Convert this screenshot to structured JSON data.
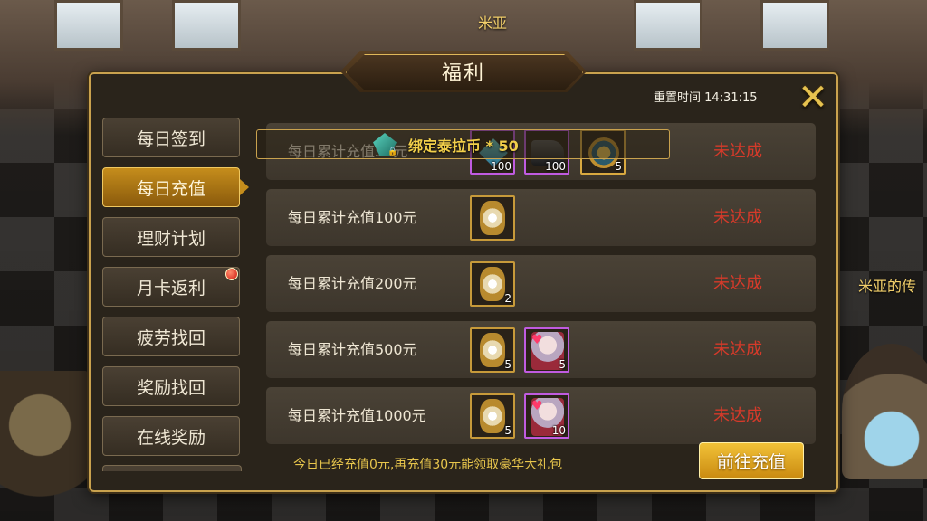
{
  "scene": {
    "npc_name": "米亚",
    "side_text": "米亚的传"
  },
  "panel": {
    "title": "福利",
    "reset_time": "重置时间 14:31:15"
  },
  "sidebar": {
    "items": [
      {
        "label": "每日签到"
      },
      {
        "label": "每日充值"
      },
      {
        "label": "理财计划"
      },
      {
        "label": "月卡返利"
      },
      {
        "label": "疲劳找回"
      },
      {
        "label": "奖励找回"
      },
      {
        "label": "在线奖励"
      }
    ],
    "active_index": 1
  },
  "rows": [
    {
      "label": "每日累计充值50元",
      "status": "未达成",
      "items": [
        {
          "icon": "gem-item",
          "count": "100"
        },
        {
          "icon": "boot-item",
          "count": "100"
        },
        {
          "icon": "coin-item",
          "count": "5"
        }
      ]
    },
    {
      "label": "每日累计充值100元",
      "status": "未达成",
      "items": [
        {
          "icon": "jar-item",
          "count": ""
        }
      ]
    },
    {
      "label": "每日累计充值200元",
      "status": "未达成",
      "items": [
        {
          "icon": "jar-item",
          "count": "2"
        }
      ]
    },
    {
      "label": "每日累计充值500元",
      "status": "未达成",
      "items": [
        {
          "icon": "jar-item",
          "count": "5"
        },
        {
          "icon": "portrait-card-item",
          "count": "5"
        }
      ]
    },
    {
      "label": "每日累计充值1000元",
      "status": "未达成",
      "items": [
        {
          "icon": "jar-item",
          "count": "5"
        },
        {
          "icon": "portrait-card-item",
          "count": "10"
        }
      ]
    }
  ],
  "tooltip": {
    "text": "绑定泰拉币 * 50"
  },
  "footer": {
    "note": "今日已经充值0元,再充值30元能领取豪华大礼包",
    "goto_button": "前往充值"
  },
  "colors": {
    "accent_gold": "#e6c24f",
    "status_red": "#d63a2a",
    "active_tab": "#c58d1c"
  }
}
